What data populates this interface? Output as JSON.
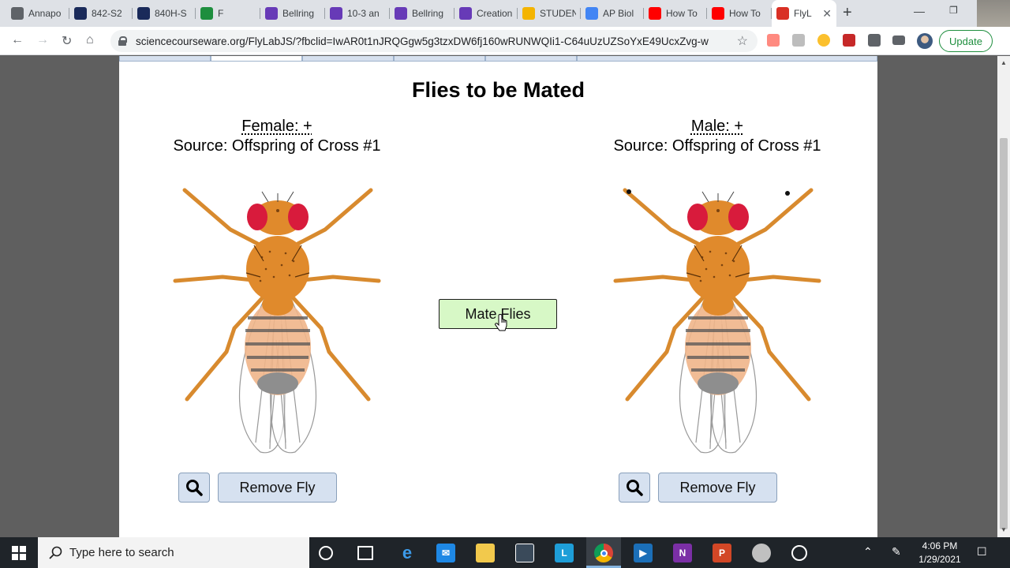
{
  "browser": {
    "tabs": [
      {
        "title": "Annapo",
        "icon": "globe-icon",
        "color": "#5f6368"
      },
      {
        "title": "842-S2",
        "icon": "v-logo-icon",
        "color": "#1a2a5a"
      },
      {
        "title": "840H-S",
        "icon": "v-logo-icon",
        "color": "#1a2a5a"
      },
      {
        "title": "F",
        "icon": "classroom-icon",
        "color": "#1e8e3e"
      },
      {
        "title": "Bellring",
        "icon": "forms-icon",
        "color": "#673ab7"
      },
      {
        "title": "10-3 an",
        "icon": "forms-icon",
        "color": "#673ab7"
      },
      {
        "title": "Bellring",
        "icon": "forms-icon",
        "color": "#673ab7"
      },
      {
        "title": "Creation",
        "icon": "forms-icon",
        "color": "#673ab7"
      },
      {
        "title": "STUDEN",
        "icon": "slides-icon",
        "color": "#f4b400"
      },
      {
        "title": "AP Biol",
        "icon": "docs-icon",
        "color": "#4285f4"
      },
      {
        "title": "How To",
        "icon": "youtube-icon",
        "color": "#ff0000"
      },
      {
        "title": "How To",
        "icon": "youtube-icon",
        "color": "#ff0000"
      },
      {
        "title": "FlyL",
        "icon": "flylab-icon",
        "color": "#d93025"
      }
    ],
    "url": "sciencecourseware.org/FlyLabJS/?fbclid=IwAR0t1nJRQGgw5g3tzxDW6fj160wRUNWQIi1-C64uUzUZSoYxE49UcxZvg-w",
    "update_label": "Update"
  },
  "page": {
    "title": "Flies to be Mated",
    "female": {
      "sex_label": "Female: +",
      "source": "Source: Offspring of Cross #1",
      "remove_label": "Remove Fly"
    },
    "male": {
      "sex_label": "Male: +",
      "source": "Source: Offspring of Cross #1",
      "remove_label": "Remove Fly"
    },
    "mate_label": "Mate Flies"
  },
  "taskbar": {
    "search_placeholder": "Type here to search",
    "time": "4:06 PM",
    "date": "1/29/2021"
  },
  "colors": {
    "mate_button": "#d7f8c6",
    "remove_button": "#d6e1f0",
    "fly_body": "#e08a2c",
    "fly_eye": "#d81b3c"
  }
}
